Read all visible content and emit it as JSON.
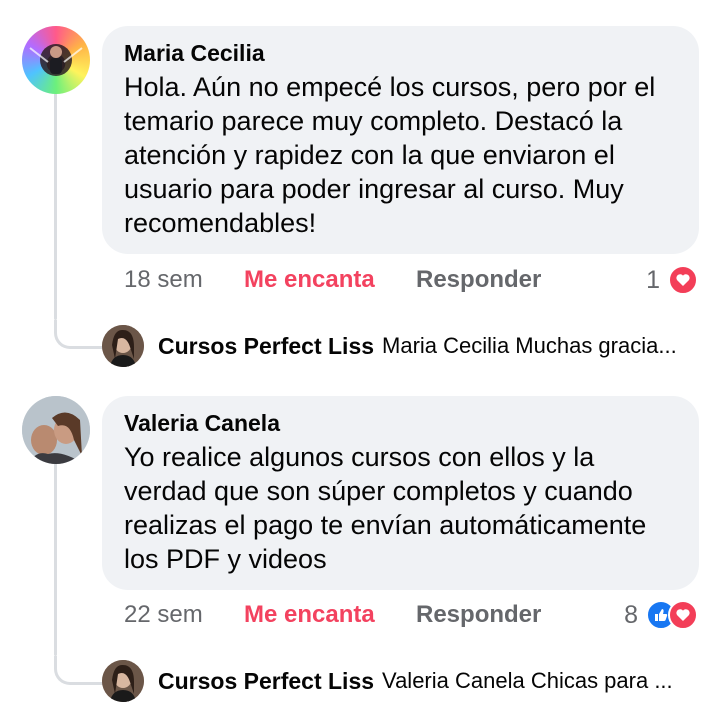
{
  "comments": [
    {
      "author": "Maria Cecilia",
      "text": "Hola. Aún no empecé los cursos, pero por el temario parece muy completo. Destacó la atención y rapidez con la que enviaron el usuario para poder ingresar al curso. Muy recomendables!",
      "time": "18 sem",
      "love_label": "Me encanta",
      "reply_label": "Responder",
      "reaction_count": "1",
      "reactions": [
        "heart-icon"
      ],
      "reply": {
        "author": "Cursos Perfect Liss",
        "preview": "Maria Cecilia Muchas gracia..."
      }
    },
    {
      "author": "Valeria Canela",
      "text": "Yo realice algunos cursos con ellos y la verdad que son súper completos y cuando realizas el pago te envían automáticamente los PDF y videos",
      "time": "22 sem",
      "love_label": "Me encanta",
      "reply_label": "Responder",
      "reaction_count": "8",
      "reactions": [
        "like-icon",
        "heart-icon"
      ],
      "reply": {
        "author": "Cursos Perfect Liss",
        "preview": "Valeria Canela Chicas para ..."
      }
    }
  ],
  "colors": {
    "bubble": "#f0f2f5",
    "love": "#f3425f",
    "secondary_text": "#65676b",
    "like": "#1877f2",
    "heart": "#f33e58"
  }
}
